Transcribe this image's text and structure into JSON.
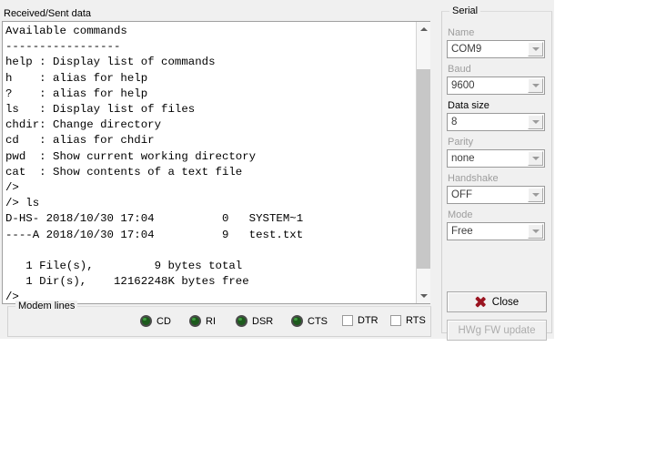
{
  "window": {
    "background": "#f0f0f0"
  },
  "terminal": {
    "title": "Received/Sent data",
    "content": "Available commands\n-----------------\nhelp : Display list of commands\nh    : alias for help\n?    : alias for help\nls   : Display list of files\nchdir: Change directory\ncd   : alias for chdir\npwd  : Show current working directory\ncat  : Show contents of a text file\n/>\n/> ls\nD-HS- 2018/10/30 17:04          0   SYSTEM~1\n----A 2018/10/30 17:04          9   test.txt\n\n   1 File(s),         9 bytes total\n   1 Dir(s),    12162248K bytes free\n/>\n/> ",
    "lines": [
      "Available commands",
      "-----------------",
      "help : Display list of commands",
      "h    : alias for help",
      "?    : alias for help",
      "ls   : Display list of files",
      "chdir: Change directory",
      "cd   : alias for chdir",
      "pwd  : Show current working directory",
      "cat  : Show contents of a text file",
      "/>",
      "/> ls",
      "D-HS- 2018/10/30 17:04          0   SYSTEM~1",
      "----A 2018/10/30 17:04          9   test.txt",
      "",
      "   1 File(s),         9 bytes total",
      "   1 Dir(s),    12162248K bytes free",
      "/>",
      "/> "
    ],
    "scrollbar": {
      "up_icon": "chevron-up-icon",
      "down_icon": "chevron-down-icon"
    }
  },
  "modem_lines": {
    "title": "Modem lines",
    "leds": [
      {
        "label": "CD",
        "state": "on",
        "color": "#1d5a1d"
      },
      {
        "label": "RI",
        "state": "on",
        "color": "#1d5a1d"
      },
      {
        "label": "DSR",
        "state": "on",
        "color": "#1d5a1d"
      },
      {
        "label": "CTS",
        "state": "on",
        "color": "#1d5a1d"
      }
    ],
    "checkboxes": [
      {
        "label": "DTR",
        "checked": false
      },
      {
        "label": "RTS",
        "checked": false
      }
    ]
  },
  "serial": {
    "title": "Serial",
    "fields": [
      {
        "label": "Name",
        "value": "COM9",
        "enabled": false
      },
      {
        "label": "Baud",
        "value": "9600",
        "enabled": false
      },
      {
        "label": "Data size",
        "value": "8",
        "enabled": true
      },
      {
        "label": "Parity",
        "value": "none",
        "enabled": false
      },
      {
        "label": "Handshake",
        "value": "OFF",
        "enabled": false
      },
      {
        "label": "Mode",
        "value": "Free",
        "enabled": false
      }
    ],
    "buttons": {
      "close": {
        "label": "Close",
        "icon": "red-x-icon",
        "icon_color": "#9a1420",
        "enabled": true
      },
      "fw_update": {
        "label": "HWg FW update",
        "enabled": false
      }
    }
  }
}
